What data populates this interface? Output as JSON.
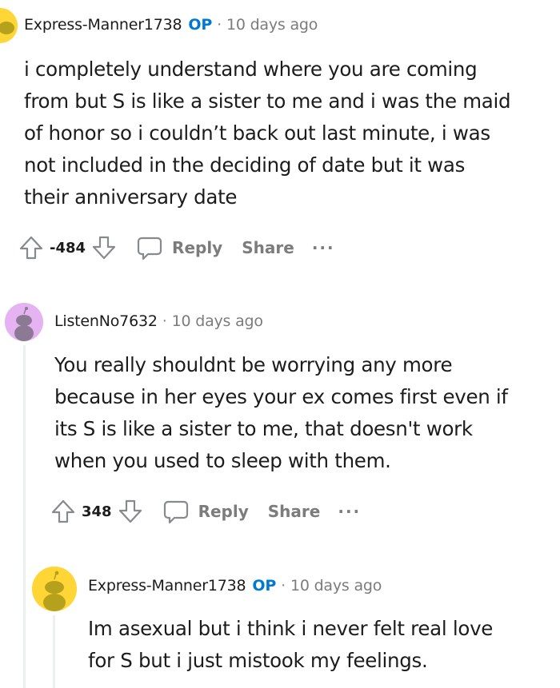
{
  "comments": [
    {
      "author": "Express-Manner1738",
      "op_badge": "OP",
      "separator": "·",
      "time": "10 days ago",
      "lines": [
        "i completely understand where you are coming",
        "from but S is like a sister to me and i was the maid",
        "of honor so i couldn’t back out last minute, i was",
        "not included in the deciding of date but it was",
        "their anniversary date"
      ],
      "score": "-484",
      "reply_label": "Reply",
      "share_label": "Share",
      "more_label": "···",
      "avatar_color": "#ffd635"
    },
    {
      "author": "ListenNo7632",
      "separator": "·",
      "time": "10 days ago",
      "lines": [
        "You really shouldnt be worrying any more",
        "because in her eyes your ex comes first even if",
        "its S is like a sister to me, that doesn't work",
        "when you used to sleep with them."
      ],
      "score": "348",
      "reply_label": "Reply",
      "share_label": "Share",
      "more_label": "···",
      "avatar_color": "#e5b3f2"
    },
    {
      "author": "Express-Manner1738",
      "op_badge": "OP",
      "separator": "·",
      "time": "10 days ago",
      "lines": [
        "Im asexual but i think i never felt real love",
        "for S but i just mistook my feelings."
      ],
      "avatar_color": "#ffd635"
    }
  ],
  "colors": {
    "op": "#0079d3",
    "muted": "#7c7c7c",
    "thread_line": "#edeff1"
  }
}
